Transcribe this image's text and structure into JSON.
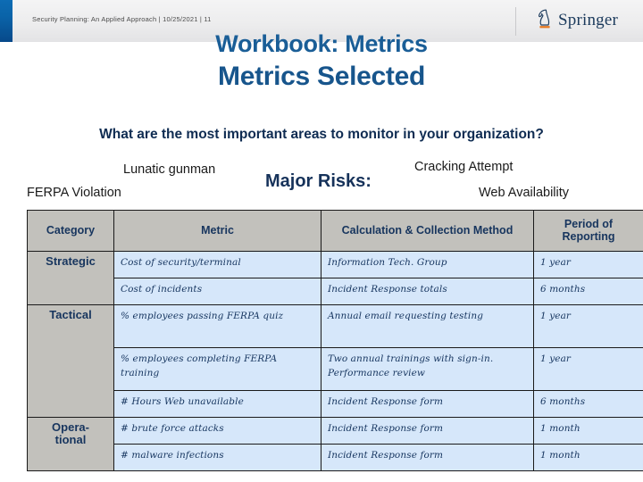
{
  "header": {
    "meta_text": "Security Planning: An Applied Approach | 10/25/2021 | 11",
    "brand_name": "Springer",
    "brand_mark_icon": "springer-knight-icon",
    "accent_color": "#0a63a8"
  },
  "title": {
    "line1": "Workbook: Metrics",
    "line2": "Metrics Selected",
    "color": "#17558c"
  },
  "question": "What are the most important areas to monitor in your organization?",
  "risks": {
    "heading": "Major Risks:",
    "items": [
      {
        "label": "Lunatic gunman"
      },
      {
        "label": "FERPA Violation"
      },
      {
        "label": "Cracking Attempt"
      },
      {
        "label": "Web Availability"
      }
    ]
  },
  "table": {
    "columns": [
      "Category",
      "Metric",
      "Calculation & Collection Method",
      "Period of Reporting"
    ],
    "header_bg": "#c2c1bc",
    "cell_bg": "#d6e7fa",
    "rows": [
      {
        "category": "Strategic",
        "category_rowspan": 2,
        "metric": "Cost of security/terminal",
        "method": "Information Tech. Group",
        "period": "1 year"
      },
      {
        "category": null,
        "metric": "Cost of incidents",
        "method": "Incident Response totals",
        "period": "6 months"
      },
      {
        "category": "Tactical",
        "category_rowspan": 3,
        "metric": "% employees passing FERPA quiz",
        "method": "Annual email requesting testing",
        "period": "1 year"
      },
      {
        "category": null,
        "metric": "% employees completing FERPA training",
        "method": "Two annual trainings with sign-in. Performance review",
        "period": "1 year"
      },
      {
        "category": null,
        "metric": "# Hours Web unavailable",
        "method": "Incident Response form",
        "period": "6 months"
      },
      {
        "category": "Opera-\ntional",
        "category_rowspan": 2,
        "metric": "# brute force attacks",
        "method": "Incident Response form",
        "period": "1 month"
      },
      {
        "category": null,
        "metric": "# malware infections",
        "method": "Incident Response form",
        "period": "1 month"
      }
    ]
  }
}
